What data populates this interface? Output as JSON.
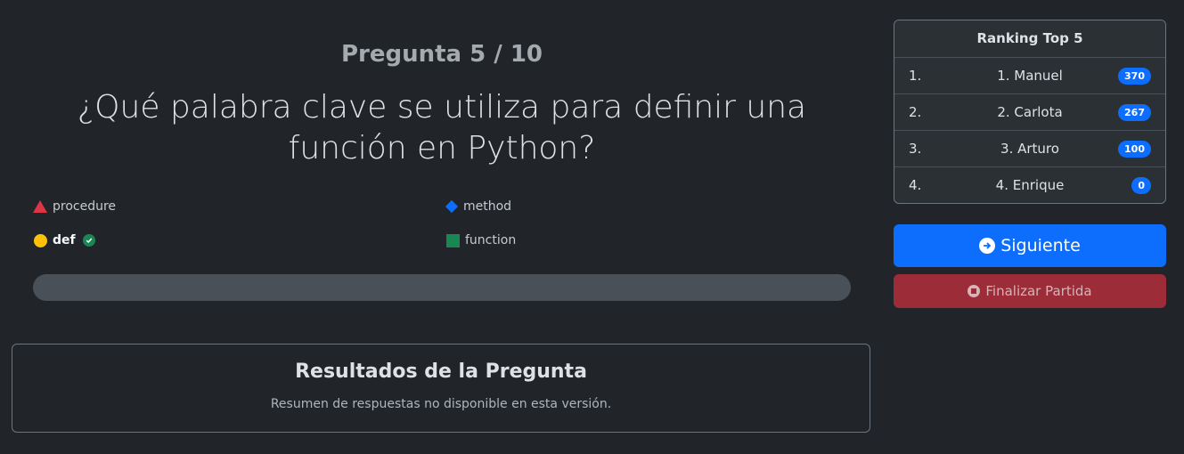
{
  "question": {
    "counter": "Pregunta 5 / 10",
    "text": "¿Qué palabra clave se utiliza para definir una función en Python?"
  },
  "options": [
    {
      "label": "procedure",
      "icon": "triangle-icon",
      "color": "#dc3545",
      "correct": false
    },
    {
      "label": "method",
      "icon": "diamond-icon",
      "color": "#0d6efd",
      "correct": false
    },
    {
      "label": "def",
      "icon": "circle-icon",
      "color": "#ffc107",
      "correct": true
    },
    {
      "label": "function",
      "icon": "square-icon",
      "color": "#198754",
      "correct": false
    }
  ],
  "progress": {
    "value_percent": 0
  },
  "results": {
    "title": "Resultados de la Pregunta",
    "text": "Resumen de respuestas no disponible en esta versión."
  },
  "ranking": {
    "title": "Ranking Top 5",
    "rows": [
      {
        "num": "1.",
        "name": "1. Manuel",
        "score": "370"
      },
      {
        "num": "2.",
        "name": "2. Carlota",
        "score": "267"
      },
      {
        "num": "3.",
        "name": "3. Arturo",
        "score": "100"
      },
      {
        "num": "4.",
        "name": "4. Enrique",
        "score": "0"
      }
    ]
  },
  "buttons": {
    "next_label": "Siguiente",
    "end_label": "Finalizar Partida"
  },
  "colors": {
    "background": "#212529",
    "primary": "#0d6efd",
    "danger": "#9b2c38",
    "success": "#198754"
  }
}
